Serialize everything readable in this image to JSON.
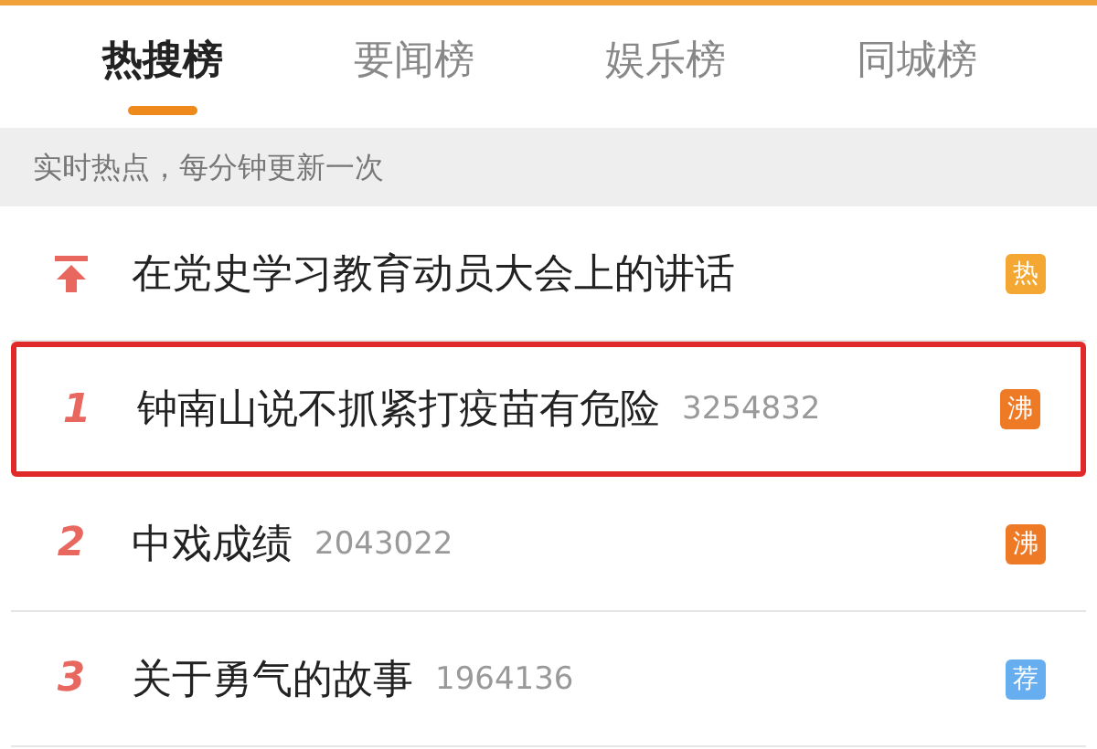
{
  "tabs": [
    {
      "label": "热搜榜",
      "selected": true
    },
    {
      "label": "要闻榜",
      "selected": false
    },
    {
      "label": "娱乐榜",
      "selected": false
    },
    {
      "label": "同城榜",
      "selected": false
    }
  ],
  "banner": "实时热点，每分钟更新一次",
  "items": [
    {
      "kind": "pinned",
      "title": "在党史学习教育动员大会上的讲话",
      "badge": "热",
      "color": "#f4a833",
      "highlighted": false
    },
    {
      "kind": "ranked",
      "rank": "1",
      "title": "钟南山说不抓紧打疫苗有危险",
      "count": "3254832",
      "badge": "沸",
      "color": "#ef7a26",
      "highlighted": true
    },
    {
      "kind": "ranked",
      "rank": "2",
      "title": "中戏成绩",
      "count": "2043022",
      "badge": "沸",
      "color": "#ef7a26",
      "highlighted": false
    },
    {
      "kind": "ranked",
      "rank": "3",
      "title": "关于勇气的故事",
      "count": "1964136",
      "badge": "荐",
      "color": "#66aef0",
      "highlighted": false
    }
  ]
}
